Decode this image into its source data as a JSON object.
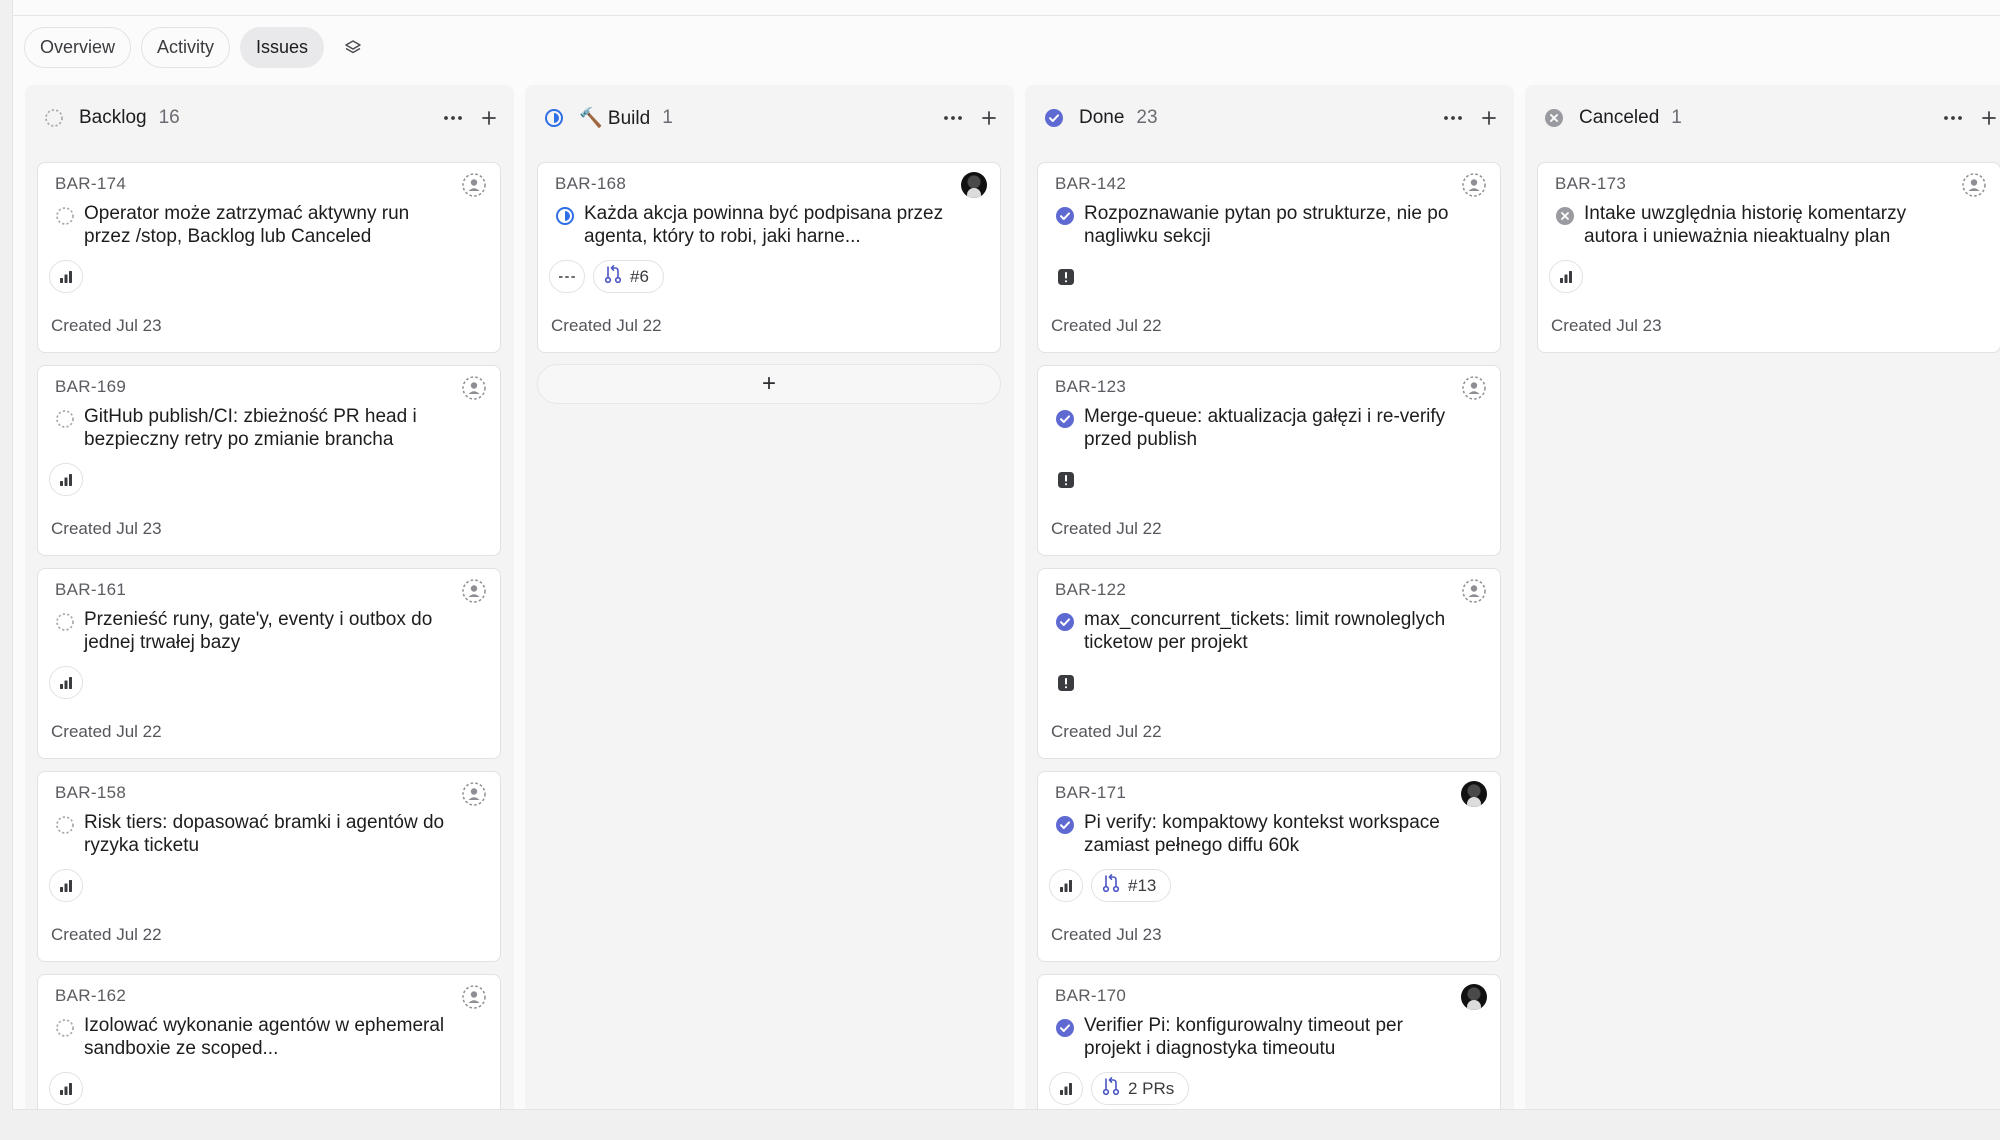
{
  "tabs": [
    {
      "label": "Overview",
      "active": false
    },
    {
      "label": "Activity",
      "active": false
    },
    {
      "label": "Issues",
      "active": true
    }
  ],
  "colors": {
    "accent": "#5e6ad2",
    "progress": "#2f6fe5",
    "canceled": "#9a9ba1",
    "backlog": "#a8a9ae"
  },
  "columns": [
    {
      "title": "Backlog",
      "count": "16",
      "status": "backlog",
      "cards": [
        {
          "id": "BAR-174",
          "title": "Operator może zatrzymać aktywny run przez /stop, Backlog lub Canceled",
          "chip": "priority",
          "created": "Created Jul 23",
          "assignee": "unassigned"
        },
        {
          "id": "BAR-169",
          "title": "GitHub publish/CI: zbieżność PR head i bezpieczny retry po zmianie brancha",
          "chip": "priority",
          "created": "Created Jul 23",
          "assignee": "unassigned"
        },
        {
          "id": "BAR-161",
          "title": "Przenieść runy, gate'y, eventy i outbox do jednej trwałej bazy",
          "chip": "priority",
          "created": "Created Jul 22",
          "assignee": "unassigned"
        },
        {
          "id": "BAR-158",
          "title": "Risk tiers: dopasować bramki i agentów do ryzyka ticketu",
          "chip": "priority",
          "created": "Created Jul 22",
          "assignee": "unassigned"
        },
        {
          "id": "BAR-162",
          "title": "Izolować wykonanie agentów w ephemeral sandboxie ze scoped...",
          "chip": "priority",
          "created": "",
          "assignee": "unassigned"
        }
      ]
    },
    {
      "title": "🔨 Build",
      "count": "1",
      "status": "progress",
      "cards": [
        {
          "id": "BAR-168",
          "title": "Każda akcja powinna być podpisana przez agenta, który to robi, jaki harne...",
          "chip": "none",
          "pr": "#6",
          "created": "Created Jul 22",
          "assignee": "avatar"
        }
      ],
      "add_label": "+"
    },
    {
      "title": "Done",
      "count": "23",
      "status": "done",
      "cards": [
        {
          "id": "BAR-142",
          "title": "Rozpoznawanie pytan po strukturze, nie po nagliwku sekcji",
          "chip": "urgent",
          "created": "Created Jul 22",
          "assignee": "unassigned"
        },
        {
          "id": "BAR-123",
          "title": "Merge-queue: aktualizacja gałęzi i re-verify przed publish",
          "chip": "urgent",
          "created": "Created Jul 22",
          "assignee": "unassigned"
        },
        {
          "id": "BAR-122",
          "title": "max_concurrent_tickets: limit rownoleglych ticketow per projekt",
          "chip": "urgent",
          "created": "Created Jul 22",
          "assignee": "unassigned"
        },
        {
          "id": "BAR-171",
          "title": "Pi verify: kompaktowy kontekst workspace zamiast pełnego diffu 60k",
          "chip": "priority",
          "pr": "#13",
          "created": "Created Jul 23",
          "assignee": "avatar"
        },
        {
          "id": "BAR-170",
          "title": "Verifier Pi: konfigurowalny timeout per projekt i diagnostyka timeoutu",
          "chip": "priority",
          "pr": "2 PRs",
          "created": "",
          "assignee": "avatar"
        }
      ]
    },
    {
      "title": "Canceled",
      "count": "1",
      "status": "canceled",
      "cards": [
        {
          "id": "BAR-173",
          "title": "Intake uwzględnia historię komentarzy autora i unieważnia nieaktualny plan",
          "chip": "priority",
          "created": "Created Jul 23",
          "assignee": "unassigned"
        }
      ]
    }
  ]
}
